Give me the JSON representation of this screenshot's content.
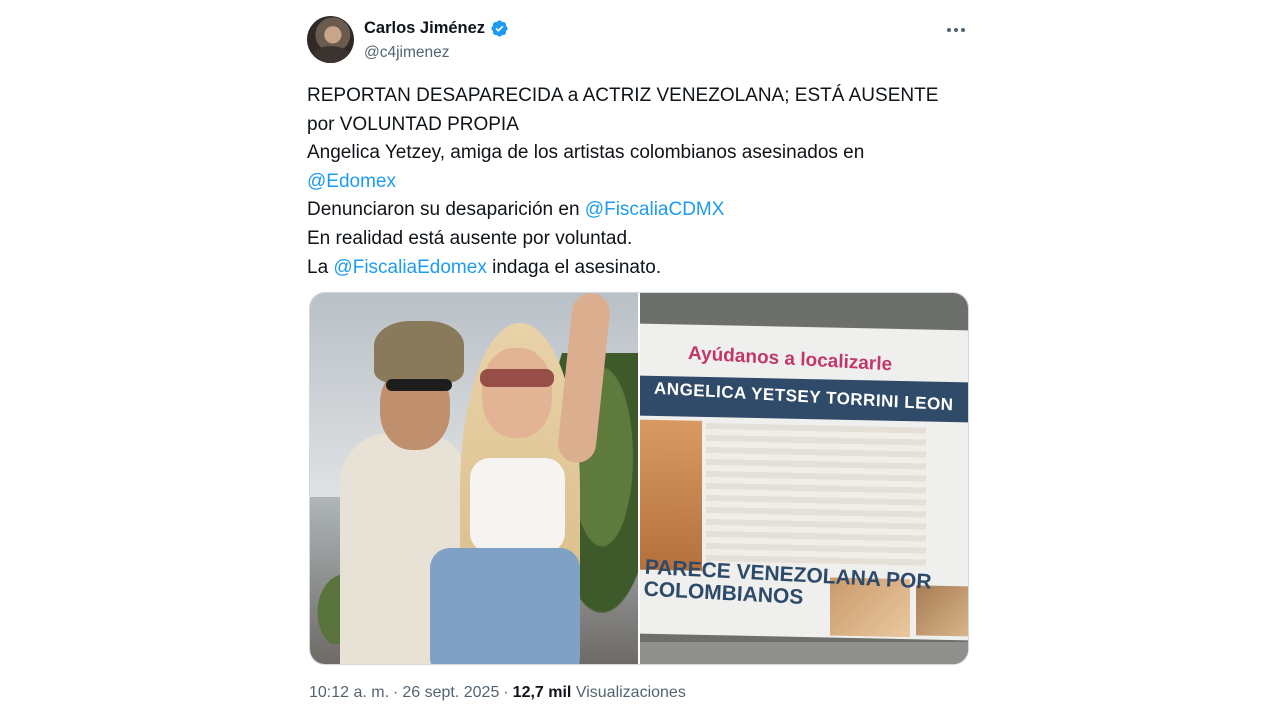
{
  "author": {
    "display_name": "Carlos Jiménez",
    "handle": "@c4jimenez",
    "verified": true,
    "verified_color": "#1d9bf0"
  },
  "tweet": {
    "lines": [
      {
        "parts": [
          {
            "text": "REPORTAN DESAPARECIDA a ACTRIZ VENEZOLANA; ESTÁ AUSENTE",
            "mention": false
          }
        ]
      },
      {
        "parts": [
          {
            "text": "por VOLUNTAD PROPIA",
            "mention": false
          }
        ]
      },
      {
        "parts": [
          {
            "text": "Angelica Yetzey, amiga de los artistas colombianos asesinados en",
            "mention": false
          }
        ]
      },
      {
        "parts": [
          {
            "text": "@Edomex",
            "mention": true
          }
        ]
      },
      {
        "parts": [
          {
            "text": "Denunciaron su desaparición en ",
            "mention": false
          },
          {
            "text": "@FiscaliaCDMX",
            "mention": true
          }
        ]
      },
      {
        "parts": [
          {
            "text": "En realidad está ausente por voluntad.",
            "mention": false
          }
        ]
      },
      {
        "parts": [
          {
            "text": "La ",
            "mention": false
          },
          {
            "text": "@FiscaliaEdomex",
            "mention": true
          },
          {
            "text": " indaga el asesinato.",
            "mention": false
          }
        ]
      }
    ],
    "mention_color": "#1d9bf0"
  },
  "media": {
    "poster_title": "Ayúdanos a localizarle",
    "poster_name": "ANGELICA YETSEY TORRINI LEON",
    "banner_line1": "PARECE VENEZOLANA POR",
    "banner_line2": "COLOMBIANOS"
  },
  "meta": {
    "time": "10:12 a. m.",
    "date": "26 sept. 2025",
    "views_count": "12,7 mil",
    "views_label": "Visualizaciones"
  }
}
